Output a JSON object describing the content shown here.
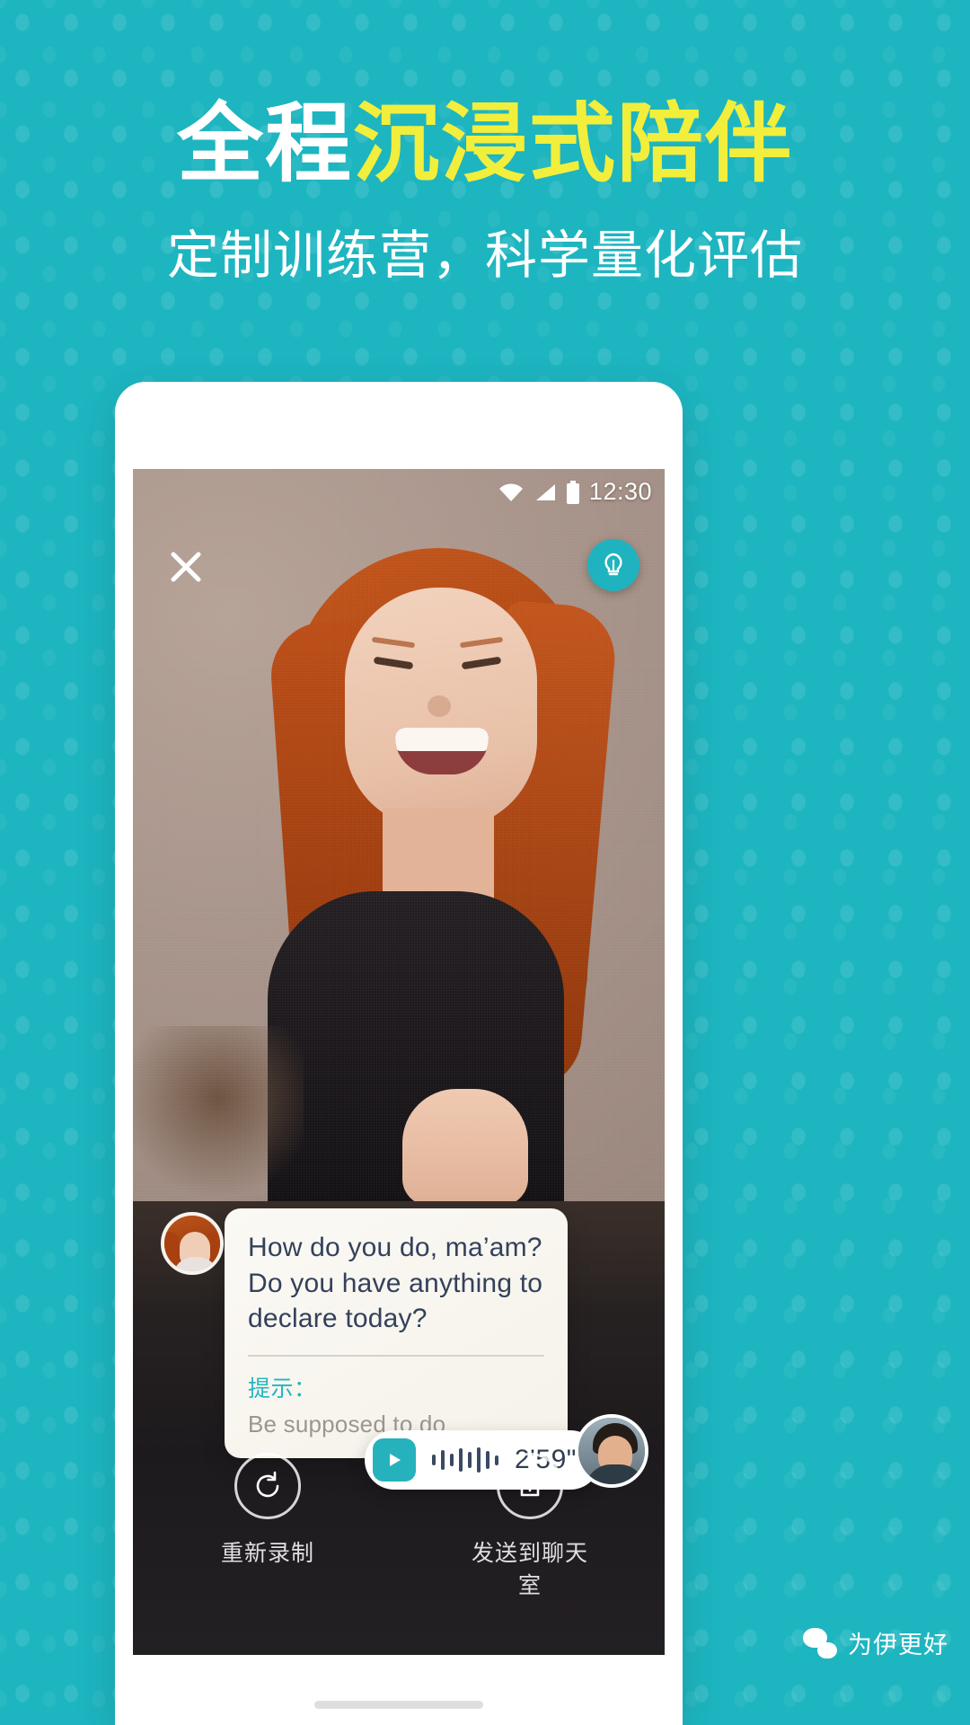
{
  "colors": {
    "background_teal": "#1db5c0",
    "headline_white": "#ffffff",
    "headline_yellow": "#f2ee3c",
    "accent_teal": "#25b2bd",
    "bubble_text": "#33415c",
    "hint_label": "#23b5c0",
    "hint_text": "#9a9790"
  },
  "poster": {
    "headline_part1": "全程",
    "headline_part2": "沉浸式陪伴",
    "subtitle": "定制训练营，科学量化评估"
  },
  "phone": {
    "status_bar": {
      "wifi_icon": "wifi-icon",
      "signal_icon": "signal-icon",
      "battery_icon": "battery-icon",
      "time": "12:30"
    },
    "top_bar": {
      "close_icon": "close-icon",
      "hint_bulb_icon": "lightbulb-icon"
    },
    "dialog": {
      "avatar_icon": "speaker-avatar",
      "line1": "How do you do, ma’am?",
      "line2": "Do you have anything to",
      "line3": "declare today?",
      "hint_label": "提示：",
      "hint_text": "Be supposed to do"
    },
    "audio": {
      "play_icon": "play-icon",
      "waveform_icon": "waveform-icon",
      "duration": "2'59\"",
      "peer_avatar_icon": "peer-avatar"
    },
    "controls": [
      {
        "icon": "rerecord-icon",
        "label": "重新录制"
      },
      {
        "icon": "share-upload-icon",
        "label": "发送到聊天室"
      }
    ]
  },
  "footer": {
    "wechat_logo_icon": "wechat-logo-icon",
    "account_name": "为伊更好"
  }
}
